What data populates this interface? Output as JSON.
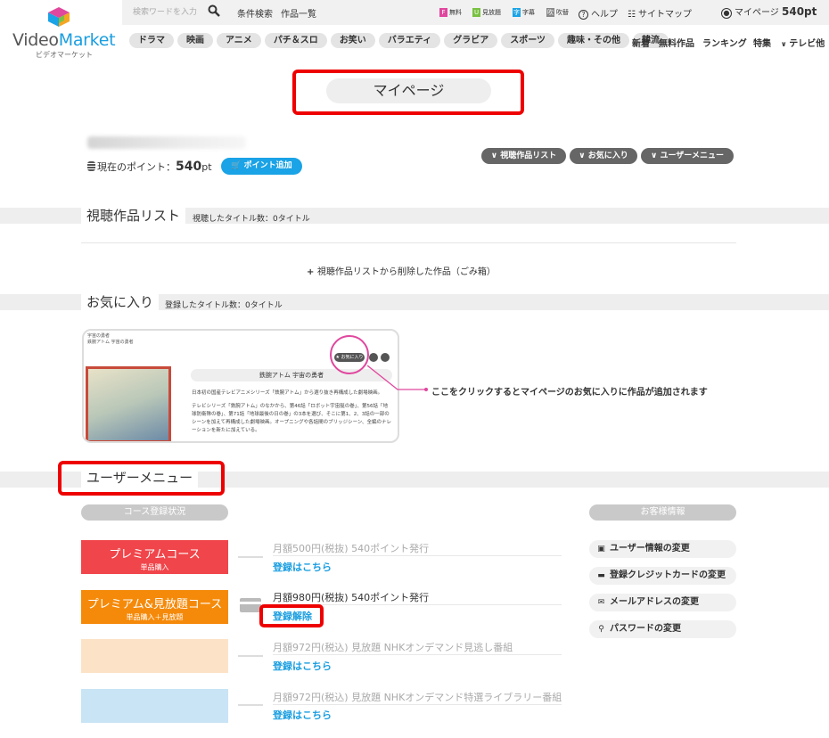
{
  "header": {
    "logo_main": "Video",
    "logo_accent": "Market",
    "logo_sub": "ビデオマーケット",
    "search_placeholder": "検索ワードを入力",
    "condition_search": "条件検索",
    "works_list": "作品一覧",
    "filter_free": "無料",
    "filter_unlimited": "見放題",
    "filter_sub": "字幕",
    "filter_dub": "吹替",
    "help": "ヘルプ",
    "sitemap": "サイトマップ",
    "mypage_label": "マイページ",
    "mypage_points": "540pt",
    "genres": [
      "ドラマ",
      "映画",
      "アニメ",
      "パチ＆スロ",
      "お笑い",
      "バラエティ",
      "グラビア",
      "スポーツ",
      "趣味・その他",
      "韓流"
    ],
    "right_nav": [
      "新着",
      "無料作品",
      "ランキング",
      "特集",
      "テレビ他"
    ]
  },
  "page": {
    "title": "マイページ",
    "points_label": "現在のポイント：",
    "points_value": "540",
    "points_unit": "pt",
    "add_points": "ポイント追加",
    "quick_links": [
      "視聴作品リスト",
      "お気に入り",
      "ユーザーメニュー"
    ]
  },
  "history": {
    "title": "視聴作品リスト",
    "count": "視聴したタイトル数：0タイトル",
    "trash_link": "視聴作品リストから削除した作品（ごみ箱）"
  },
  "favorites": {
    "title": "お気に入り",
    "count": "登録したタイトル数：0タイトル",
    "card_top1": "宇宙の勇者",
    "card_top2": "鉄腕アトム 宇宙の勇者",
    "card_title": "鉄腕アトム 宇宙の勇者",
    "card_btn": "★ お気に入り",
    "card_desc1": "日本初の国産テレビアニメシリーズ「鉄腕アトム」から選り抜き再構成した劇場映画。",
    "card_desc2": "テレビシリーズ「鉄腕アトム」のなかから、第46話「ロボット宇宙艇の巻」、第56話「地球防衛隊の巻」、第71話「地球最後の日の巻」の3本を選び、そこに第1、2、3話の一部のシーンを加えて再構成した劇場映画。オープニングや各話間のブリッジシーン、全編のナレーションを新たに加えている。",
    "hint": "ここをクリックするとマイページのお気に入りに作品が追加されます"
  },
  "user_menu": {
    "title": "ユーザーメニュー",
    "course_header": "コース登録状況",
    "customer_header": "お客様情報",
    "courses": [
      {
        "name": "プレミアムコース",
        "sub": "単品購入",
        "color": "#f0454a",
        "desc": "月額500円(税抜) 540ポイント発行",
        "link": "登録はこちら"
      },
      {
        "name": "プレミアム&見放題コース",
        "sub": "単品購入＋見放題",
        "color": "#f58a0a",
        "desc": "月額980円(税抜) 540ポイント発行",
        "link": "登録解除"
      },
      {
        "name": "",
        "sub": "",
        "color": "#fce3c8",
        "desc": "月額972円(税込) 見放題 NHKオンデマンド見逃し番組",
        "link": "登録はこちら"
      },
      {
        "name": "",
        "sub": "",
        "color": "#c8e4f5",
        "desc": "月額972円(税込) 見放題 NHKオンデマンド特選ライブラリー番組",
        "link": "登録はこちら"
      }
    ],
    "customer_items": [
      {
        "icon": "id-card-icon",
        "label": "ユーザー情報の変更"
      },
      {
        "icon": "credit-card-icon",
        "label": "登録クレジットカードの変更"
      },
      {
        "icon": "envelope-icon",
        "label": "メールアドレスの変更"
      },
      {
        "icon": "key-icon",
        "label": "パスワードの変更"
      }
    ]
  }
}
